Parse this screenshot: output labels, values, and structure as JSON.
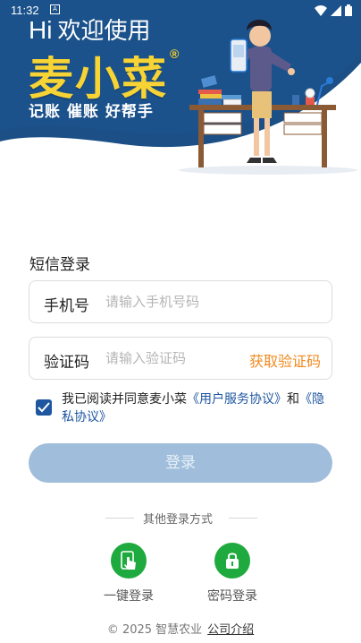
{
  "status_bar": {
    "time": "11:32",
    "notification_glyph": "A"
  },
  "hero": {
    "hi": "Hi",
    "welcome": "欢迎使用",
    "brand": "麦小菜",
    "trademark": "®",
    "slogan": "记账  催账  好帮手",
    "colors": {
      "banner": "#1b4f86",
      "brand": "#f8d334"
    }
  },
  "login": {
    "section_title": "短信登录",
    "phone_label": "手机号",
    "phone_value": "",
    "phone_placeholder": "请输入手机号码",
    "code_label": "验证码",
    "code_value": "",
    "code_placeholder": "请输入验证码",
    "get_code": "获取验证码",
    "agreement": {
      "checked": true,
      "prefix": "我已阅读并同意麦小菜",
      "service_link": "《用户服务协议》",
      "and": "和",
      "privacy_link": "《隐私协议》"
    },
    "submit": "登录"
  },
  "other_login": {
    "title": "其他登录方式",
    "one_key": "一键登录",
    "password": "密码登录"
  },
  "footer": {
    "copyright": "© 2025 智慧农业",
    "company_link": "公司介绍"
  },
  "theme": {
    "accent": "#1e56a0",
    "orange": "#f08a1e",
    "green": "#1eaa3e",
    "button_disabled": "#a0bedb"
  }
}
